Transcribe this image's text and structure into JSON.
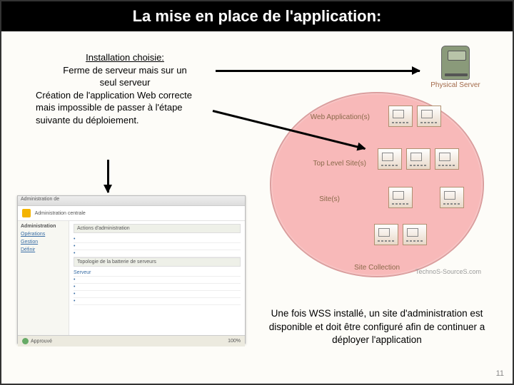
{
  "title": "La mise en place de l'application:",
  "desc": {
    "heading": "Installation choisie:",
    "line1": "Ferme de serveur mais sur un",
    "line2": "seul serveur",
    "para": "Création de l'application Web correcte mais impossible de passer à l'étape suivante du déploiement."
  },
  "diagram": {
    "server_label": "Physical Server",
    "layer1": "Web Application(s)",
    "layer2": "Top Level Site(s)",
    "layer3": "Site(s)",
    "layer4": "Site Collection",
    "watermark": "TechnoS-SourceS.com"
  },
  "admin": {
    "breadcrumb": "Administration de",
    "title": "Administration centrale",
    "nav_section": "Administration",
    "nav_item1": "Opérations",
    "nav_item2": "Gestion",
    "nav_item3": "Définir",
    "section1": "Actions d'administration",
    "section2": "Topologie de la batterie de serveurs",
    "col1": "Serveur",
    "foot_status": "Approuvé",
    "foot_pct": "100%"
  },
  "bottom_text": "Une fois WSS installé, un site d'administration est disponible et doit être configuré afin de continuer a déployer l'application",
  "page_number": "11"
}
